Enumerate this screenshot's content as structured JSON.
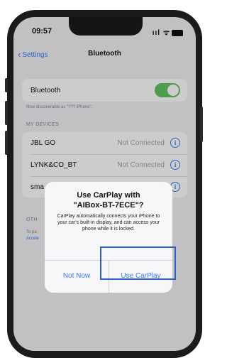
{
  "status_bar": {
    "time": "09:57",
    "signal_glyphs": "ııl ᯤ"
  },
  "nav": {
    "back_label": "Settings",
    "title": "Bluetooth"
  },
  "bluetooth_toggle": {
    "label": "Bluetooth",
    "on": true,
    "color": "#63c466"
  },
  "discoverable_note": "Now discoverable as \"??? iPhone\".",
  "my_devices": {
    "header": "MY DEVICES",
    "items": [
      {
        "name": "JBL GO",
        "status": "Not Connected"
      },
      {
        "name": "LYNK&CO_BT",
        "status": "Not Connected"
      },
      {
        "name": "sma",
        "status": ""
      }
    ]
  },
  "other_devices": {
    "header": "OTH",
    "note_line1": "To pa",
    "note_line2": "Accele"
  },
  "alert": {
    "title_line1": "Use CarPlay with",
    "title_line2": "\"AIBox-BT-7ECE\"?",
    "message": "CarPlay automatically connects your iPhone to your car's built-in display, and can access your phone while it is locked.",
    "cancel_label": "Not Now",
    "confirm_label": "Use CarPlay"
  },
  "colors": {
    "accent": "#3a7cf5",
    "highlight": "#2f5fb8"
  }
}
